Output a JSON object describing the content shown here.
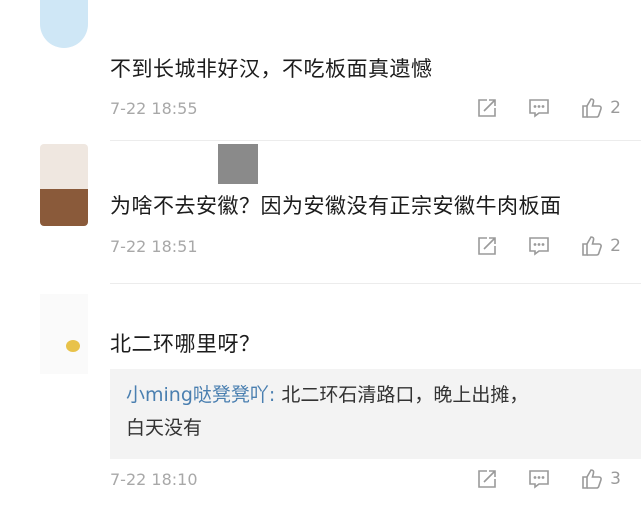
{
  "comments": [
    {
      "text": "不到长城非好汉，不吃板面真遗憾",
      "date": "7-22 18:55",
      "likes": "2"
    },
    {
      "text": "为啥不去安徽？因为安徽没有正宗安徽牛肉板面",
      "date": "7-22 18:51",
      "likes": "2"
    },
    {
      "text": "北二环哪里呀？",
      "date": "7-22 18:10",
      "likes": "3",
      "reply": {
        "user": "小ming哒凳凳吖:",
        "text_line1": " 北二环石清路口，晚上出摊，",
        "text_line2": "白天没有"
      }
    }
  ],
  "colors": {
    "reply_user": "#4a7fb0",
    "meta": "#a8a8a8",
    "icon": "#9a9a9a"
  },
  "icons": [
    "share-icon",
    "comment-icon",
    "thumbs-up-icon"
  ]
}
